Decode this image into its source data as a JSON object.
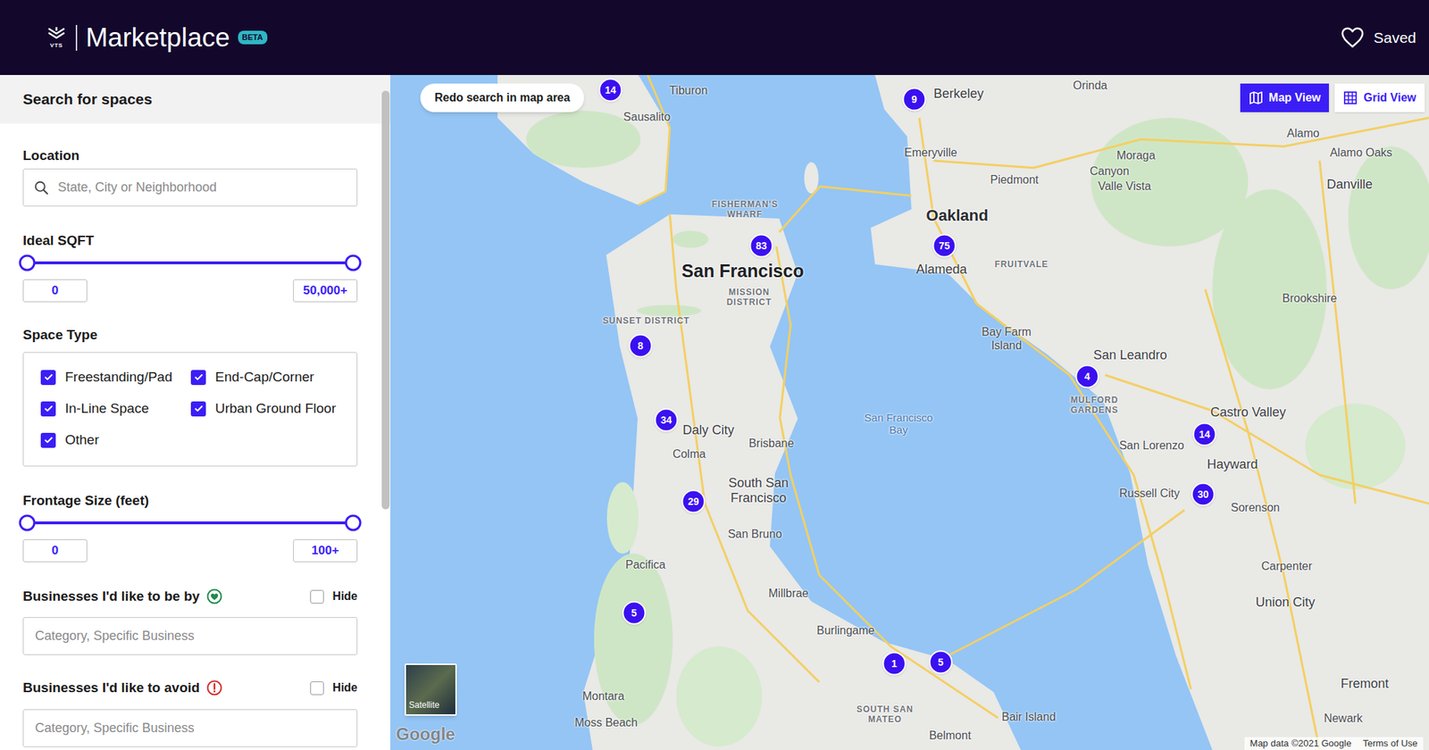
{
  "header": {
    "logo_text": "VTS",
    "title": "Marketplace",
    "badge": "BETA",
    "saved": "Saved"
  },
  "sidebar": {
    "heading": "Search for spaces",
    "location": {
      "label": "Location",
      "placeholder": "State, City or Neighborhood"
    },
    "sqft": {
      "label": "Ideal SQFT",
      "low_level": 0,
      "level": 1,
      "min": "0",
      "max": "50,000+"
    },
    "space_type": {
      "label": "Space Type",
      "options": [
        {
          "label": "Freestanding/Pad",
          "checked": true
        },
        {
          "label": "End-Cap/Corner",
          "checked": true
        },
        {
          "label": "In-Line Space",
          "checked": true
        },
        {
          "label": "Urban Ground Floor",
          "checked": true
        },
        {
          "label": "Other",
          "checked": true
        }
      ]
    },
    "frontage": {
      "label": "Frontage Size (feet)",
      "low_level": 0,
      "level": 1,
      "min": "0",
      "max": "100+"
    },
    "near": {
      "label": "Businesses I'd like to be by",
      "hide": {
        "label": "Hide",
        "checked": false
      },
      "placeholder": "Category, Specific Business"
    },
    "avoid": {
      "label": "Businesses I'd like to avoid",
      "hide": {
        "label": "Hide",
        "checked": false
      },
      "placeholder": "Category, Specific Business"
    }
  },
  "map": {
    "redo_button": "Redo search in map area",
    "views": [
      {
        "label": "Map View",
        "selected": true
      },
      {
        "label": "Grid View",
        "selected": false
      }
    ],
    "pins": [
      {
        "count": "14"
      },
      {
        "count": "9"
      },
      {
        "count": "83"
      },
      {
        "count": "75"
      },
      {
        "count": "8"
      },
      {
        "count": "4"
      },
      {
        "count": "34"
      },
      {
        "count": "14"
      },
      {
        "count": "29"
      },
      {
        "count": "30"
      },
      {
        "count": "5"
      },
      {
        "count": "1"
      },
      {
        "count": "5"
      }
    ],
    "labels": [
      {
        "text": "Tiburon",
        "kind": "city"
      },
      {
        "text": "Sausalito",
        "kind": "city"
      },
      {
        "text": "Orinda",
        "kind": "city"
      },
      {
        "text": "Berkeley",
        "kind": "city-lg"
      },
      {
        "text": "Emeryville",
        "kind": "city"
      },
      {
        "text": "Piedmont",
        "kind": "city"
      },
      {
        "text": "Oakland",
        "kind": "major"
      },
      {
        "text": "Alameda",
        "kind": "city-lg"
      },
      {
        "text": "Alamo",
        "kind": "city"
      },
      {
        "text": "Alamo Oaks",
        "kind": "city"
      },
      {
        "text": "Canyon",
        "kind": "city"
      },
      {
        "text": "Moraga",
        "kind": "city"
      },
      {
        "text": "Valle Vista",
        "kind": "city"
      },
      {
        "text": "Danville",
        "kind": "city-lg"
      },
      {
        "text": "FISHERMAN'S WHARF",
        "kind": "district"
      },
      {
        "text": "San Francisco",
        "kind": "capital"
      },
      {
        "text": "MISSION DISTRICT",
        "kind": "district"
      },
      {
        "text": "SUNSET DISTRICT",
        "kind": "district"
      },
      {
        "text": "FRUITVALE",
        "kind": "district"
      },
      {
        "text": "Bay Farm Island",
        "kind": "city"
      },
      {
        "text": "Brookshire",
        "kind": "city"
      },
      {
        "text": "San Leandro",
        "kind": "city-lg"
      },
      {
        "text": "MULFORD GARDENS",
        "kind": "district"
      },
      {
        "text": "San Francisco Bay",
        "kind": "water"
      },
      {
        "text": "Daly City",
        "kind": "city-lg"
      },
      {
        "text": "Colma",
        "kind": "city"
      },
      {
        "text": "Brisbane",
        "kind": "city"
      },
      {
        "text": "Castro Valley",
        "kind": "city-lg"
      },
      {
        "text": "San Lorenzo",
        "kind": "city"
      },
      {
        "text": "Hayward",
        "kind": "city-lg"
      },
      {
        "text": "South San Francisco",
        "kind": "city-lg"
      },
      {
        "text": "Russell City",
        "kind": "city"
      },
      {
        "text": "Sorenson",
        "kind": "city"
      },
      {
        "text": "San Bruno",
        "kind": "city"
      },
      {
        "text": "Pacifica",
        "kind": "city"
      },
      {
        "text": "Carpenter",
        "kind": "city"
      },
      {
        "text": "Millbrae",
        "kind": "city"
      },
      {
        "text": "Union City",
        "kind": "city-lg"
      },
      {
        "text": "Burlingame",
        "kind": "city"
      },
      {
        "text": "Montara",
        "kind": "city"
      },
      {
        "text": "Fremont",
        "kind": "city-lg"
      },
      {
        "text": "Moss Beach",
        "kind": "city"
      },
      {
        "text": "Bair Island",
        "kind": "city"
      },
      {
        "text": "Newark",
        "kind": "city"
      },
      {
        "text": "SOUTH SAN MATEO",
        "kind": "district"
      },
      {
        "text": "Belmont",
        "kind": "city"
      }
    ],
    "satellite": "Satellite",
    "logo": "Google",
    "footer": [
      "Map data ©2021 Google",
      "Terms of Use"
    ]
  }
}
